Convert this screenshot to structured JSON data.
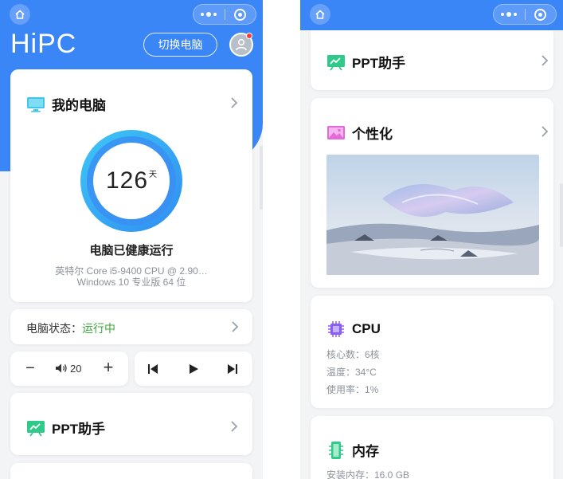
{
  "left": {
    "logo": "HiPC",
    "switch_label": "切换电脑",
    "my_pc": {
      "title": "我的电脑",
      "uptime_value": "126",
      "uptime_unit": "天",
      "health_text": "电脑已健康运行",
      "cpu_name": "英特尔 Core i5-9400 CPU @ 2.90…",
      "os_name": "Windows 10 专业版 64 位"
    },
    "status": {
      "label": "电脑状态：",
      "value": "运行中"
    },
    "volume": {
      "minus": "−",
      "value": "20",
      "plus": "+"
    },
    "ppt": {
      "title": "PPT助手"
    }
  },
  "right": {
    "ppt": {
      "title": "PPT助手"
    },
    "personalize": {
      "title": "个性化"
    },
    "cpu": {
      "title": "CPU",
      "cores": "核心数：6核",
      "temp": "温度：34°C",
      "usage": "使用率：1%"
    },
    "memory": {
      "title": "内存",
      "installed": "安装内存：16.0 GB"
    }
  },
  "colors": {
    "brand_blue": "#3b86f7",
    "status_green": "#3fa53a",
    "ring_outer": "#38bdf5",
    "ring_inner": "#2f7df0"
  },
  "icons": [
    "home-icon",
    "more-dots-icon",
    "target-icon",
    "user-icon",
    "monitor-icon",
    "chevron-right-icon",
    "volume-icon",
    "prev-track-icon",
    "play-icon",
    "next-track-icon",
    "presentation-icon",
    "image-icon",
    "chip-icon",
    "memory-icon"
  ]
}
